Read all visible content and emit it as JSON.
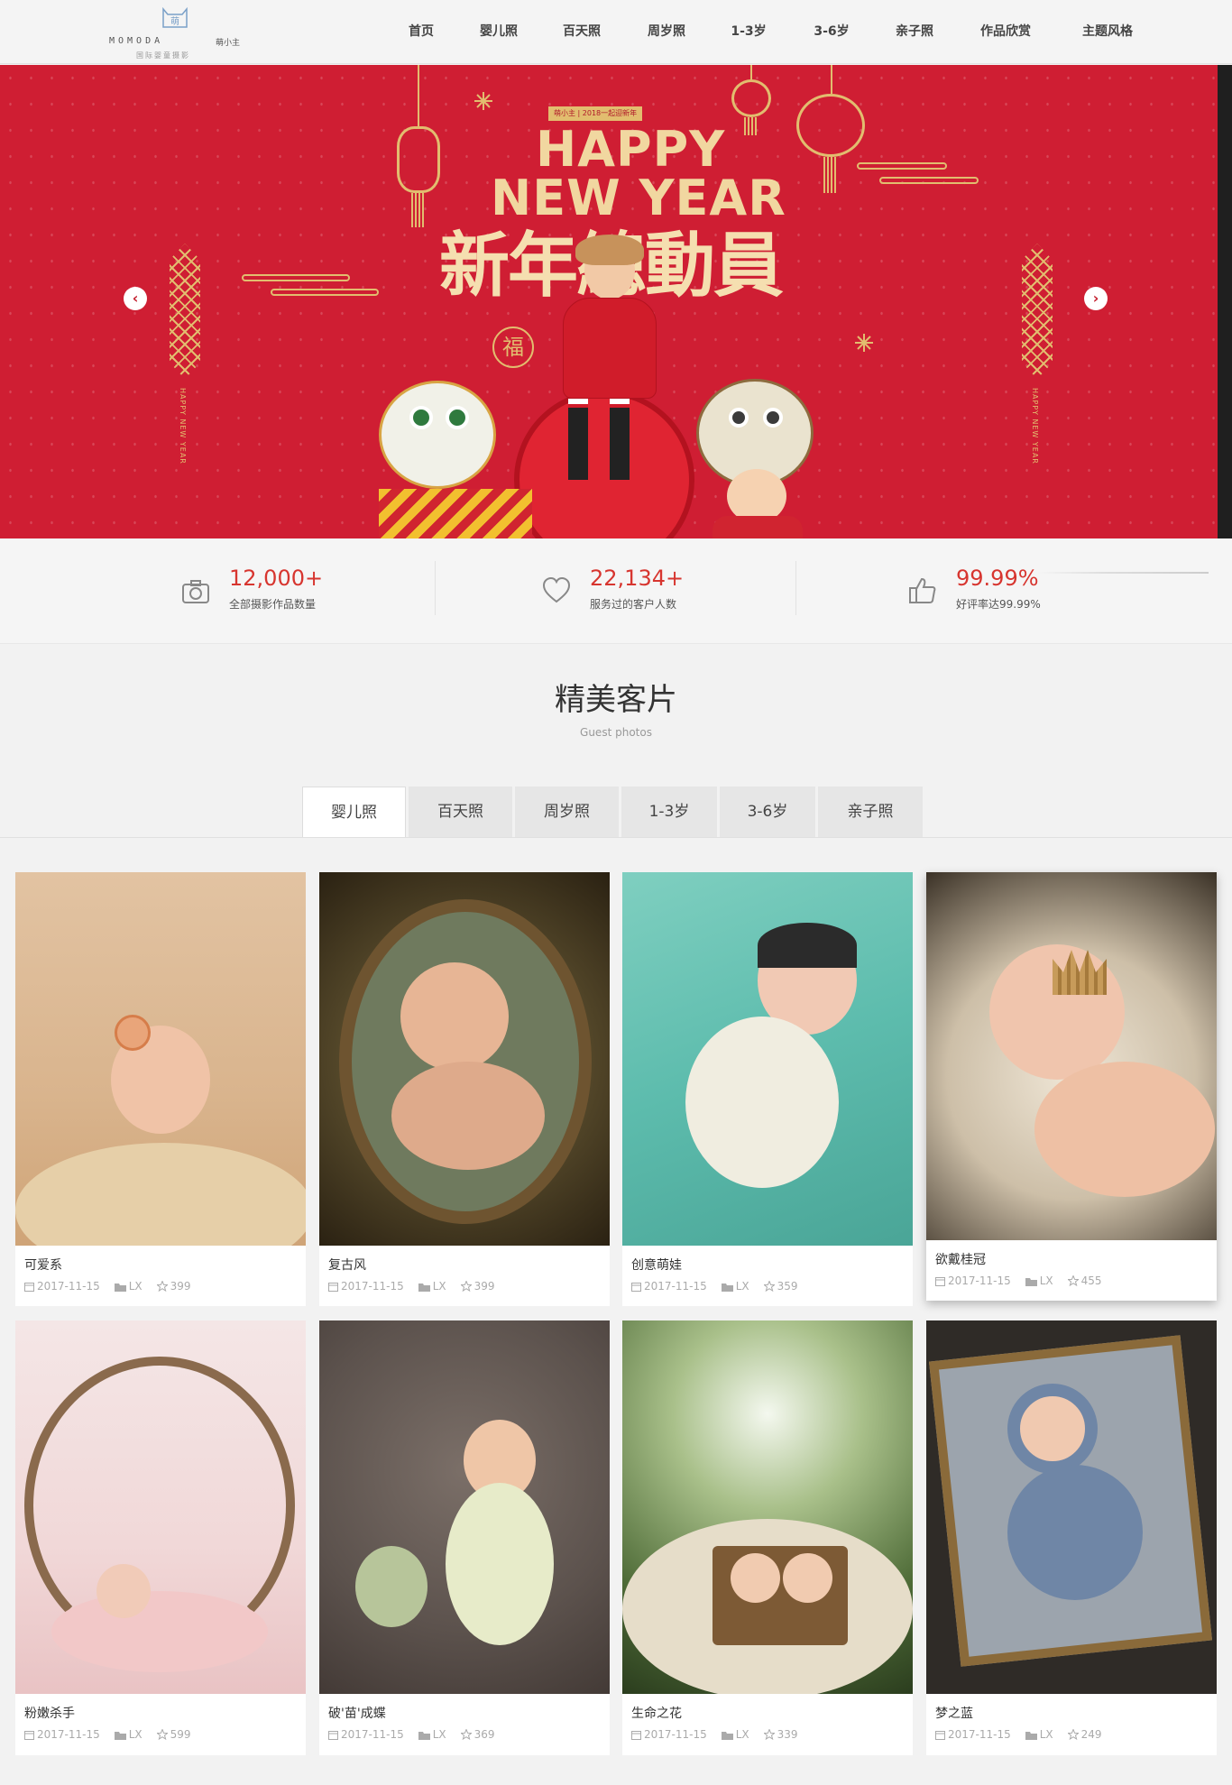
{
  "header": {
    "logo_brand": "MOMODA",
    "logo_brand_cn": "萌小主",
    "logo_sub": "国际婴童摄影",
    "logo_mark": "萌",
    "nav": [
      "首页",
      "婴儿照",
      "百天照",
      "周岁照",
      "1-3岁",
      "3-6岁",
      "亲子照",
      "作品欣赏",
      "主题风格"
    ]
  },
  "banner": {
    "tag": "萌小主 | 2018一起迎新年",
    "line1": "HAPPY",
    "line2": "NEW YEAR",
    "headline_cn": "新年總動員",
    "side_text": "HAPPY NEW YEAR",
    "fu": "福",
    "prev_arrow": "‹",
    "next_arrow": "›"
  },
  "stats": [
    {
      "icon": "camera-icon",
      "number": "12,000+",
      "label": "全部摄影作品数量"
    },
    {
      "icon": "heart-icon",
      "number": "22,134+",
      "label": "服务过的客户人数"
    },
    {
      "icon": "thumbs-up-icon",
      "number": "99.99%",
      "label": "好评率达99.99%"
    }
  ],
  "section": {
    "title": "精美客片",
    "subtitle": "Guest photos"
  },
  "tabs": [
    "婴儿照",
    "百天照",
    "周岁照",
    "1-3岁",
    "3-6岁",
    "亲子照"
  ],
  "active_tab": "婴儿照",
  "cards": [
    {
      "title": "可爱系",
      "date": "2017-11-15",
      "author": "LX",
      "views": "399"
    },
    {
      "title": "复古风",
      "date": "2017-11-15",
      "author": "LX",
      "views": "399"
    },
    {
      "title": "创意萌娃",
      "date": "2017-11-15",
      "author": "LX",
      "views": "359"
    },
    {
      "title": "欲戴桂冠",
      "date": "2017-11-15",
      "author": "LX",
      "views": "455"
    },
    {
      "title": "粉嫩杀手",
      "date": "2017-11-15",
      "author": "LX",
      "views": "599"
    },
    {
      "title": "破'苗'成蝶",
      "date": "2017-11-15",
      "author": "LX",
      "views": "369"
    },
    {
      "title": "生命之花",
      "date": "2017-11-15",
      "author": "LX",
      "views": "339"
    },
    {
      "title": "梦之蓝",
      "date": "2017-11-15",
      "author": "LX",
      "views": "249"
    }
  ],
  "colors": {
    "accent_red": "#d7352f",
    "banner_red": "#cf1e33",
    "gold": "#e2bd6f"
  }
}
